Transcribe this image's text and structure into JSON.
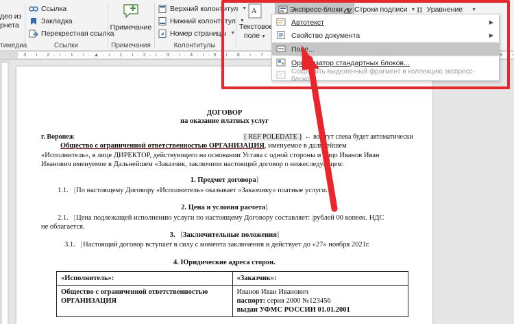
{
  "ribbon": {
    "media_group": {
      "line1": "део из",
      "line2": "рнета",
      "label": "тимедиа"
    },
    "links_group": {
      "link": "Ссылка",
      "bookmark": "Закладка",
      "cross_ref": "Перекрестная ссылка",
      "label": "Ссылки"
    },
    "comments_group": {
      "comment": "Примечание",
      "label": "Примечания"
    },
    "header_footer_group": {
      "header": "Верхний колонтитул",
      "footer": "Нижний колонтитул",
      "page_number": "Номер страницы",
      "label": "Колонтитулы"
    },
    "text_group": {
      "textbox_line1": "Текстовое",
      "textbox_line2": "поле"
    },
    "quick_parts": "Экспресс-блоки",
    "signature_line": "Строки подписи",
    "equation": "Уравнение",
    "equation_symbol": "π"
  },
  "quick_parts_menu": [
    {
      "label": "Автотекст",
      "has_submenu": true,
      "enabled": true,
      "selected": false
    },
    {
      "label": "Свойство документа",
      "has_submenu": true,
      "enabled": true,
      "selected": false
    },
    {
      "label": "Поле...",
      "has_submenu": false,
      "enabled": true,
      "selected": true
    },
    {
      "label": "Организатор стандартных блоков...",
      "has_submenu": false,
      "enabled": true,
      "selected": false
    },
    {
      "label": "Сохранить выделенный фрагмент в коллекцию экспресс-блоков...",
      "has_submenu": false,
      "enabled": false,
      "selected": false
    }
  ],
  "ruler_text": "· 3 · ı · 2 · ı · 1 · ı · ▲ · ı · 1 · ı · 2 · ı · 3 · ı · 4 · ı · 5 · ı · 6 · ı · 7 · ı · 8 · ı · 9 · ı · 10 · ı · 11 · ı · 12 · ı · 13 · ı · 14 · ı · 15 · ı · 16 · ı · 17 ·",
  "document": {
    "title": "ДОГОВОР",
    "subtitle": "на оказание платных услуг",
    "city": "г. Воронеж",
    "field_code": "{ REF POLEDATE }",
    "field_note": "← вот тут слева будет автоматически",
    "para1_line1_bold": "Общество с ограниченной ответственностью ОРГАНИЗАЦИЯ",
    "para1_line1_rest": ", именуемое в дальнейшем",
    "para1_line2": "«Исполнитель», в лице ДИРЕКТОР, действующего на основании Устава с одной стороны и лицо Иванов Иван",
    "para1_line3": "Иванович именуемое в Дальнейшем «Заказчик, заключили настоящий договор о нижеследующем:",
    "s1_title": "1. Предмет договора",
    "s1_num": "1.1.",
    "s1_text": "По настоящему Договору «Исполнитель» оказывает «Заказчику» платные услуги.",
    "s2_title": "2. Цена и условия расчета",
    "s2_num": "2.1.",
    "s2_text_a": "Цена подлежащей исполнению услуги по настоящему Договору составляет: ",
    "s2_text_b": "рублей 00 копеек. НДС",
    "s2_line2": "не облагается.",
    "s3_num": "3.",
    "s3_title": "Заключительные положения",
    "s3_sub_num": "3.1.",
    "s3_text": "Настоящий договор вступает в силу с момента заключения и действует до «27» ноября 2021г.",
    "s4_title": "4. Юридические адреса сторон.",
    "table": {
      "h1": "«Исполнитель»:",
      "h2": "«Заказчик»:",
      "left_line1": "Общество с ограниченной ответственностью",
      "left_line2": "ОРГАНИЗАЦИЯ",
      "right_line1": "Иванов Иван Иванович",
      "right_line2_label": "паспорт:",
      "right_line2_value": " серия 2000 №123456",
      "right_line3": "выдан УФМС РОССИИ 01.01.2001"
    }
  },
  "colors": {
    "highlight": "#e8262b",
    "arrow": "#e8262b",
    "menu_selected": "#c5c5c5"
  }
}
